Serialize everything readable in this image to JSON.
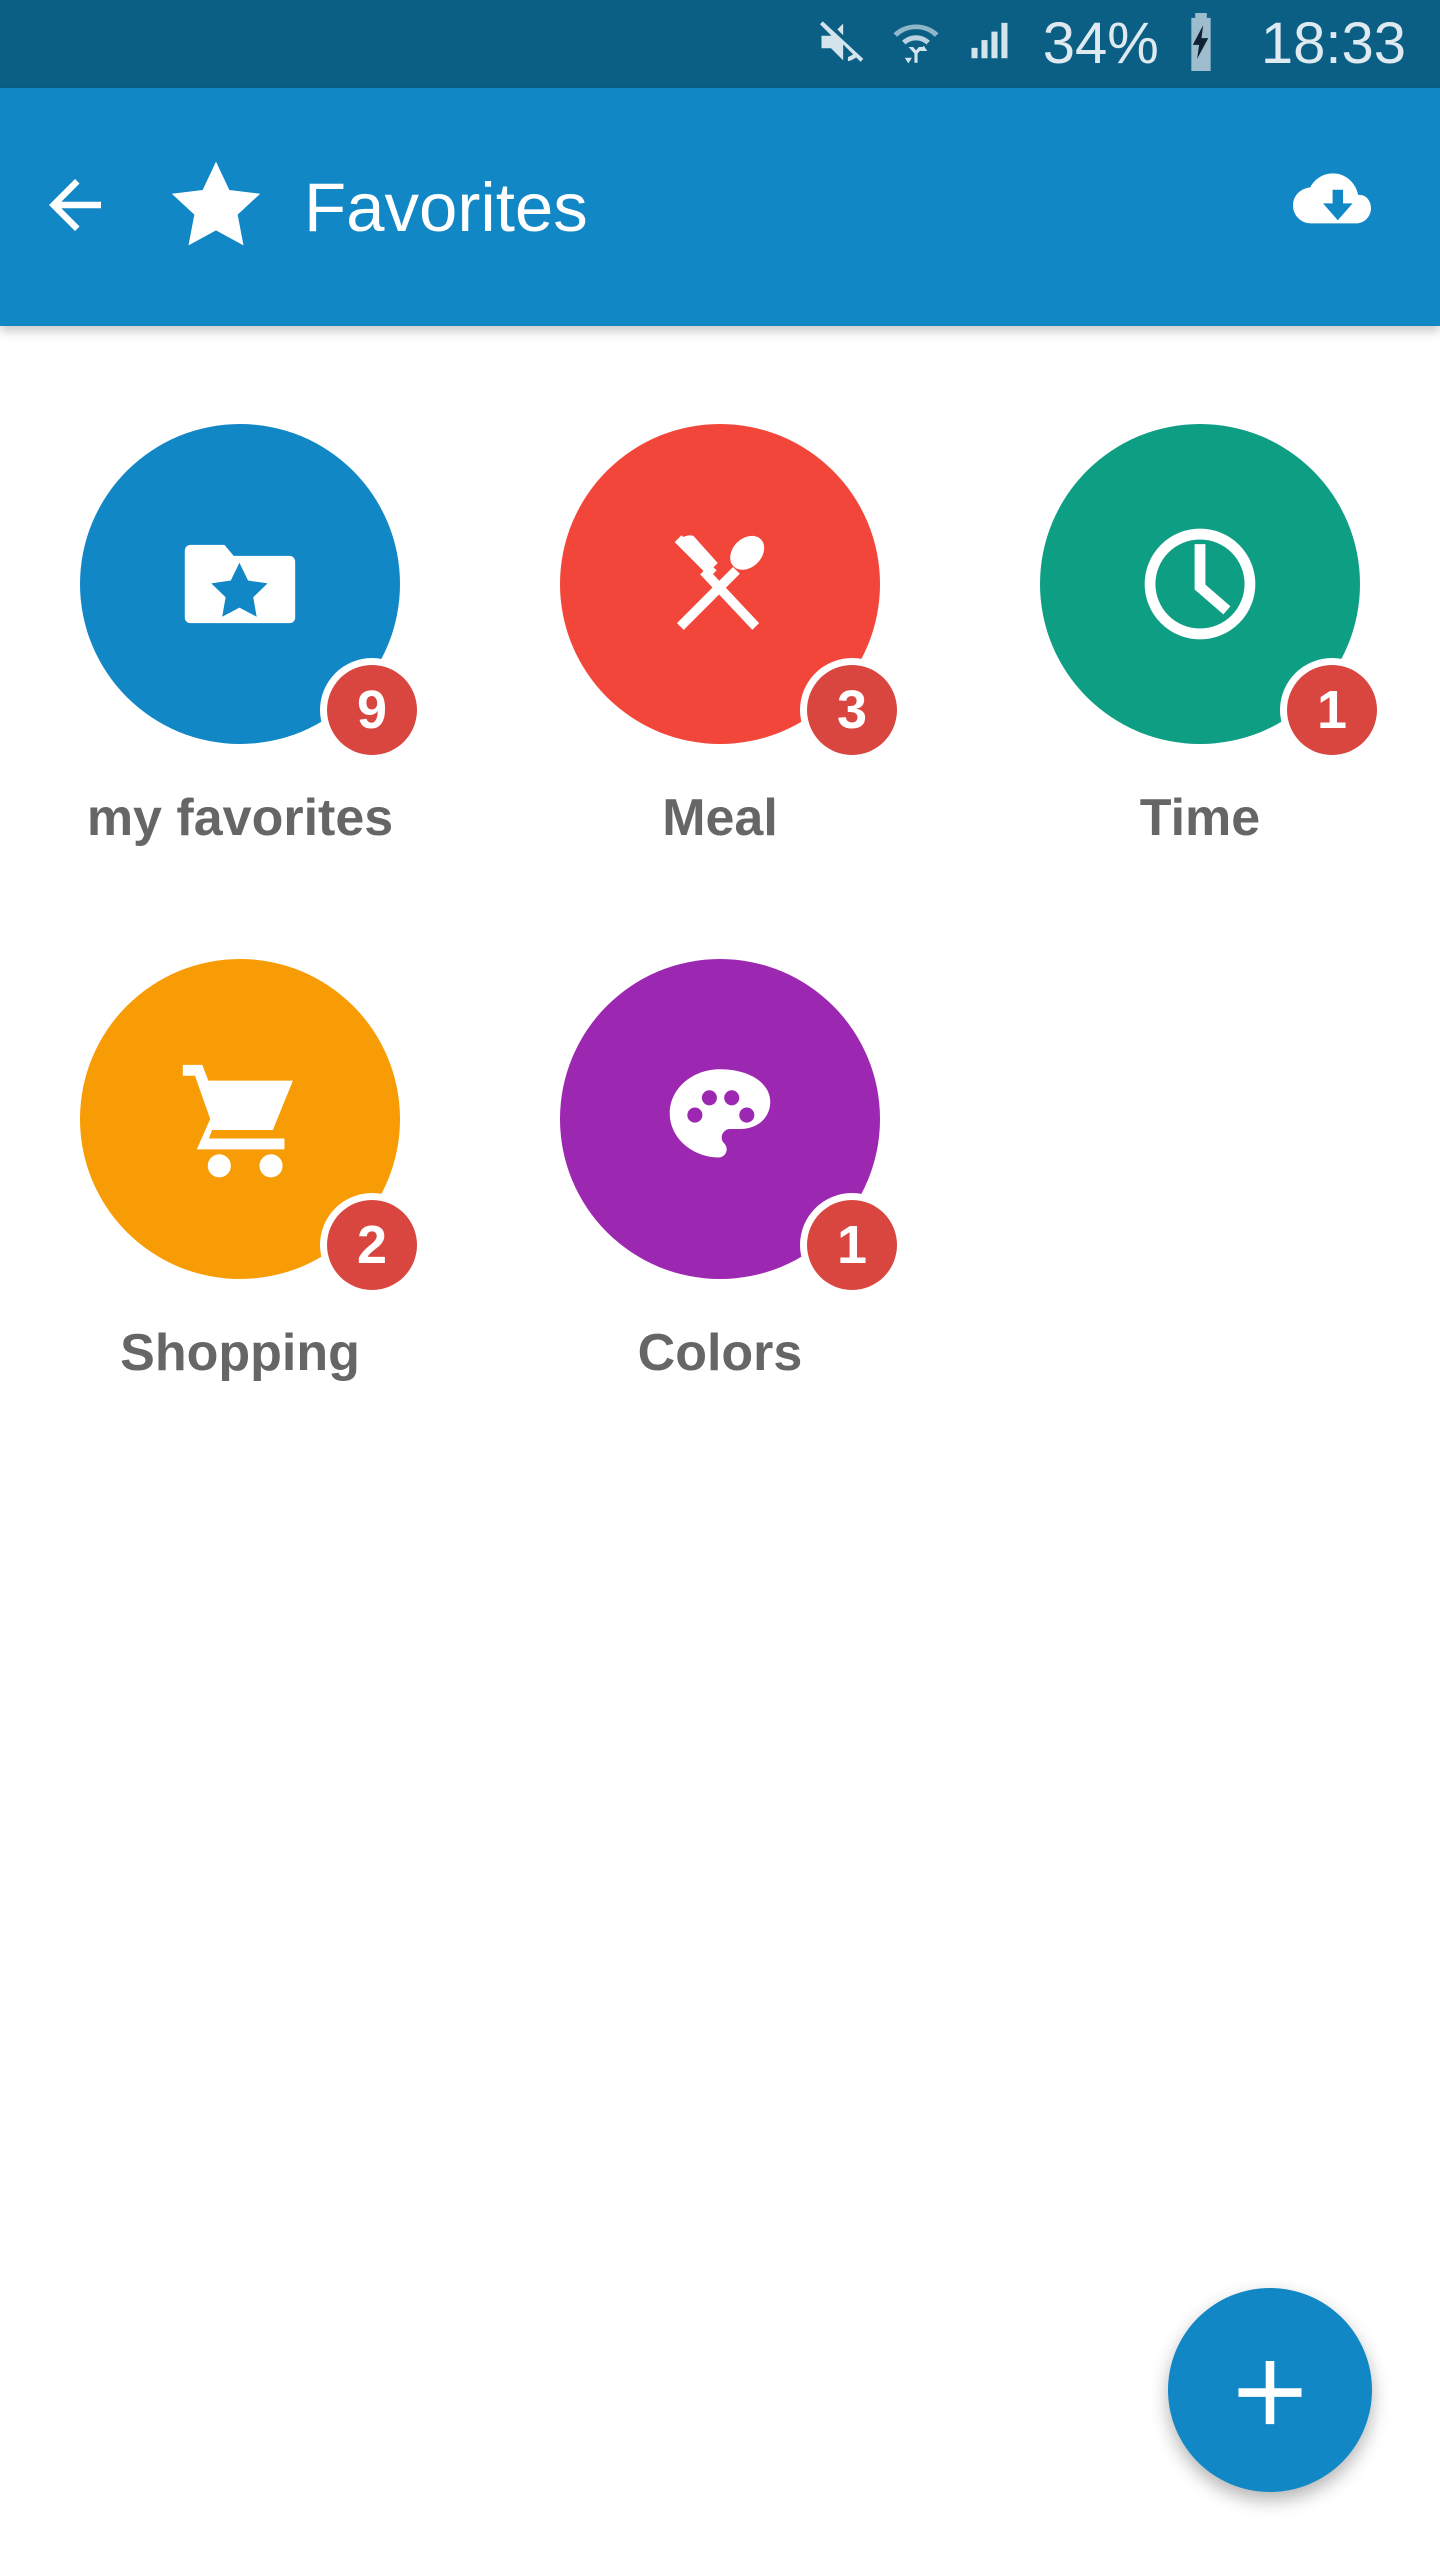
{
  "colors": {
    "status_bar_bg": "#0b5f85",
    "app_bar_bg": "#1187c6",
    "page_bg": "#ffffff",
    "badge_red": "#d9463f",
    "label_gray": "#666666",
    "fab_blue": "#1187c6"
  },
  "status_bar": {
    "mute_icon": "mute-icon",
    "wifi_icon": "wifi-transfer-icon",
    "signal_icon": "cellular-signal-icon",
    "battery_percent": "34%",
    "battery_icon": "battery-charging-icon",
    "clock": "18:33"
  },
  "app_bar": {
    "back_icon": "back-arrow-icon",
    "brand_icon": "star-icon",
    "title": "Favorites",
    "action_icon": "cloud-download-icon"
  },
  "grid": {
    "items": [
      {
        "label": "my favorites",
        "badge": "9",
        "color": "#1187c6",
        "icon": "folder-star-icon"
      },
      {
        "label": "Meal",
        "badge": "3",
        "color": "#f2463a",
        "icon": "cutlery-icon"
      },
      {
        "label": "Time",
        "badge": "1",
        "color": "#0d9e84",
        "icon": "clock-icon"
      },
      {
        "label": "Shopping",
        "badge": "2",
        "color": "#f89c05",
        "icon": "shopping-cart-icon"
      },
      {
        "label": "Colors",
        "badge": "1",
        "color": "#9c27b0",
        "icon": "palette-icon"
      }
    ]
  },
  "fab": {
    "icon": "plus-icon",
    "label": "+"
  }
}
